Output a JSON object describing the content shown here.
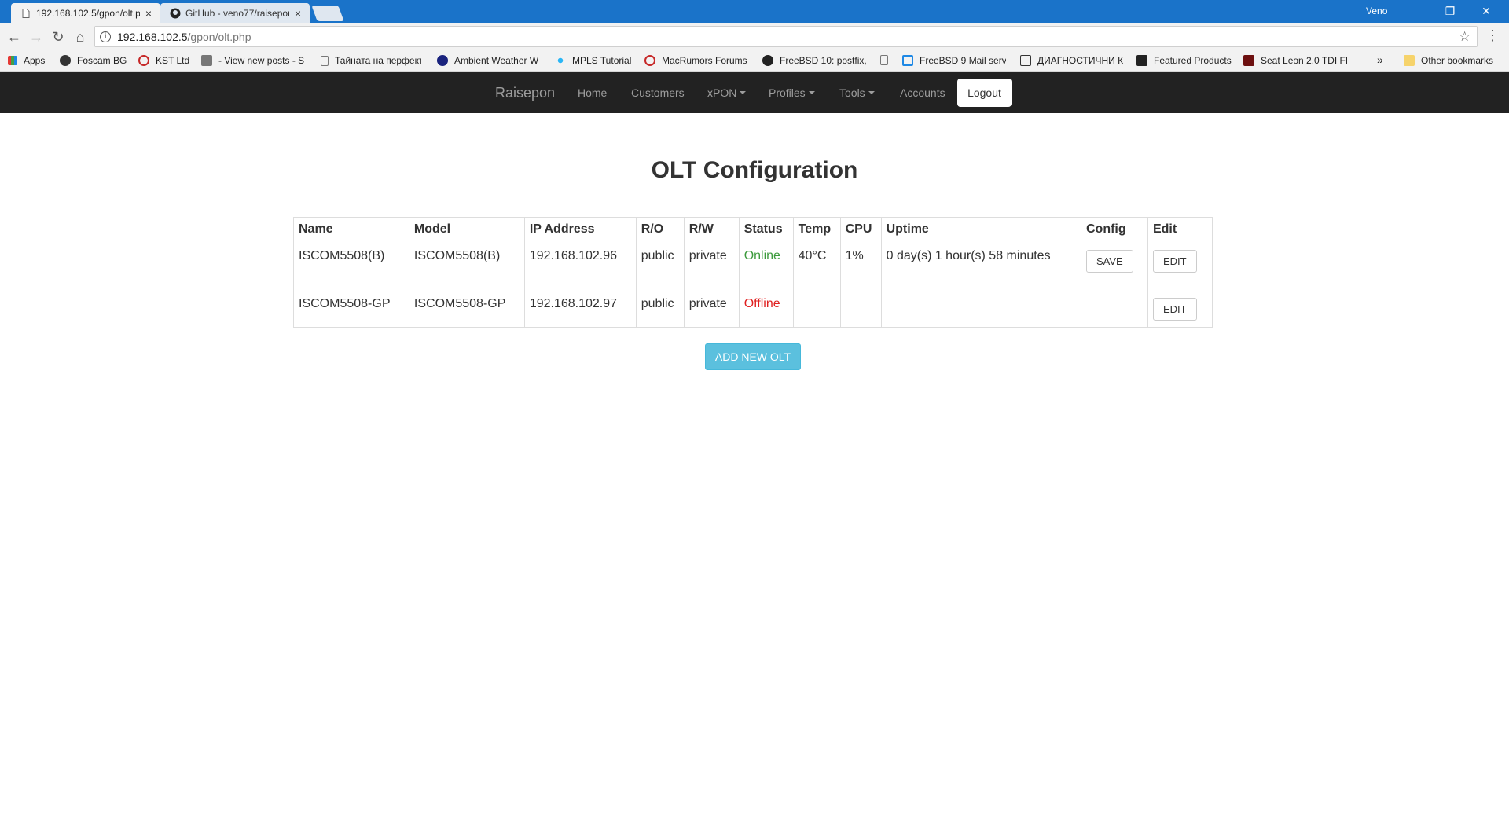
{
  "browser": {
    "tabs": [
      {
        "title": "192.168.102.5/gpon/olt.php",
        "active": true
      },
      {
        "title": "GitHub - veno77/raisepon",
        "active": false
      }
    ],
    "user": "Veno",
    "url_host": "192.168.102.5",
    "url_path": "/gpon/olt.php",
    "bookmarks": [
      {
        "label": "Apps",
        "icon": "apps-grid-icon"
      },
      {
        "label": "Foscam BG",
        "icon": "foscam-icon"
      },
      {
        "label": "KST Ltd",
        "icon": "kst-icon"
      },
      {
        "label": "- View new posts - S",
        "icon": "w-icon"
      },
      {
        "label": "Тайната на перфект",
        "icon": "page-icon"
      },
      {
        "label": "Ambient Weather W",
        "icon": "globe-icon"
      },
      {
        "label": "MPLS Tutorial",
        "icon": "dots-icon"
      },
      {
        "label": "MacRumors Forums",
        "icon": "macrumors-icon"
      },
      {
        "label": "FreeBSD 10: postfix,",
        "icon": "freebsd-icon"
      },
      {
        "label": "FreeBSD 9 Mail serv",
        "icon": "window-icon"
      },
      {
        "label": "ДИАГНОСТИЧНИ К",
        "icon": "clipboard-icon"
      },
      {
        "label": "Featured Products",
        "icon": "product-icon"
      },
      {
        "label": "Seat Leon 2.0 TDI FR",
        "icon": "seat-icon"
      }
    ],
    "overflow": "»",
    "other_bookmarks": "Other bookmarks"
  },
  "navbar": {
    "brand": "Raisepon",
    "items": [
      {
        "label": "Home"
      },
      {
        "label": "Customers"
      },
      {
        "label": "xPON"
      },
      {
        "label": "Profiles"
      },
      {
        "label": "Tools"
      },
      {
        "label": "Accounts"
      }
    ],
    "logout": "Logout"
  },
  "page": {
    "title": "OLT Configuration",
    "columns": [
      "Name",
      "Model",
      "IP Address",
      "R/O",
      "R/W",
      "Status",
      "Temp",
      "CPU",
      "Uptime",
      "Config",
      "Edit"
    ],
    "rows": [
      {
        "name": "ISCOM5508(B)",
        "model": "ISCOM5508(B)",
        "ip": "192.168.102.96",
        "ro": "public",
        "rw": "private",
        "status": "Online",
        "temp": "40°C",
        "cpu": "1%",
        "uptime": "0 day(s) 1 hour(s) 58 minutes",
        "config": "SAVE",
        "edit": "EDIT"
      },
      {
        "name": "ISCOM5508-GP",
        "model": "ISCOM5508-GP",
        "ip": "192.168.102.97",
        "ro": "public",
        "rw": "private",
        "status": "Offline",
        "temp": "",
        "cpu": "",
        "uptime": "",
        "config": "",
        "edit": "EDIT"
      }
    ],
    "add_button": "ADD NEW OLT"
  },
  "colors": {
    "navbar_bg": "#222222",
    "online": "#3c9a3c",
    "offline": "#e02020",
    "add_button": "#5bc0de",
    "tabstrip": "#1a73c9"
  }
}
